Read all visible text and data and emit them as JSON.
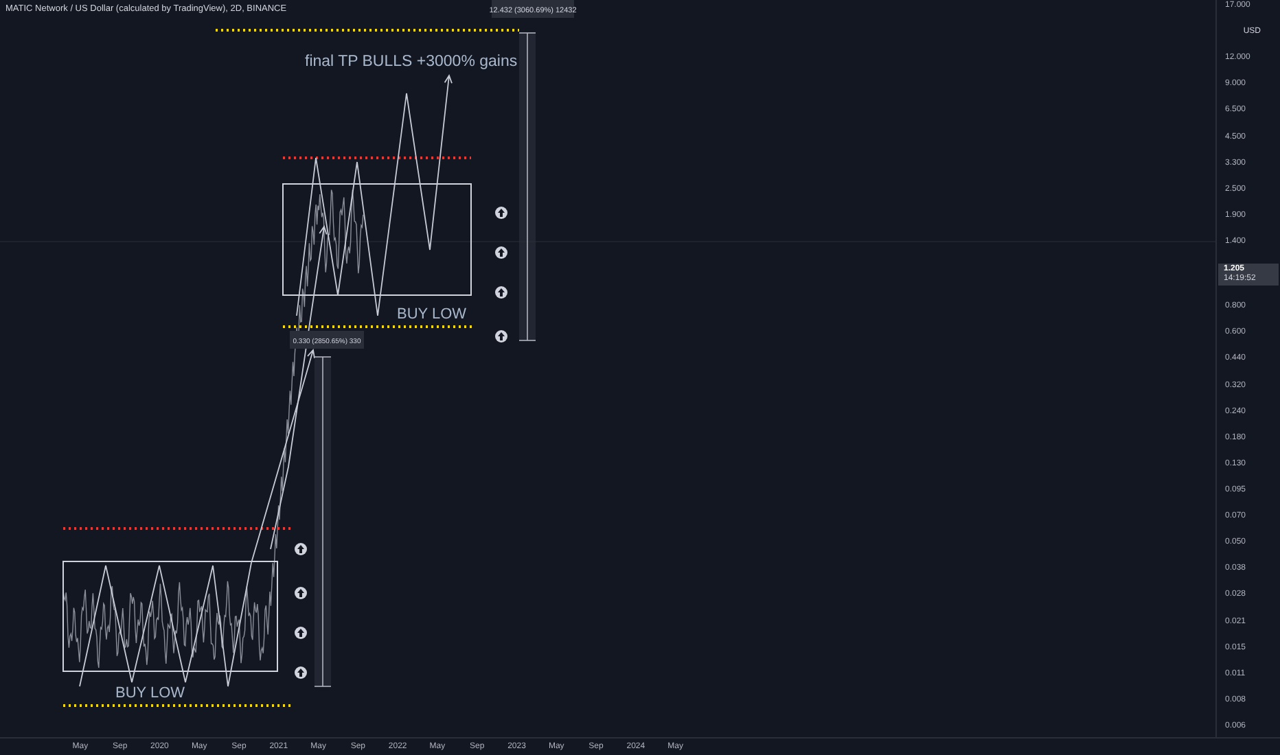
{
  "header": {
    "title": "MATIC Network / US Dollar (calculated by TradingView), 2D, BINANCE"
  },
  "chart": {
    "target_label": "final TP BULLS +3000% gains",
    "buy_labels": [
      "BUY LOW",
      "BUY LOW"
    ],
    "measures": [
      {
        "label": "12.432 (3060.69%) 12432"
      },
      {
        "label": "0.330 (2850.65%) 330"
      }
    ]
  },
  "price_axis": {
    "labels": [
      {
        "kind": "cut",
        "text": "17.000"
      },
      {
        "kind": "unit",
        "text": "USD"
      },
      {
        "kind": "tick",
        "text": "12.000"
      },
      {
        "kind": "tick",
        "text": "9.000"
      },
      {
        "kind": "tick",
        "text": "6.500"
      },
      {
        "kind": "tick",
        "text": "4.500"
      },
      {
        "kind": "tick",
        "text": "3.300"
      },
      {
        "kind": "tick",
        "text": "2.500"
      },
      {
        "kind": "tick",
        "text": "1.900"
      },
      {
        "kind": "tick",
        "text": "1.400"
      },
      {
        "kind": "tick",
        "text": "0.800"
      },
      {
        "kind": "tick",
        "text": "0.600"
      },
      {
        "kind": "tick",
        "text": "0.440"
      },
      {
        "kind": "tick",
        "text": "0.320"
      },
      {
        "kind": "tick",
        "text": "0.240"
      },
      {
        "kind": "tick",
        "text": "0.180"
      },
      {
        "kind": "tick",
        "text": "0.130"
      },
      {
        "kind": "tick",
        "text": "0.095"
      },
      {
        "kind": "tick",
        "text": "0.070"
      },
      {
        "kind": "tick",
        "text": "0.050"
      },
      {
        "kind": "tick",
        "text": "0.038"
      },
      {
        "kind": "tick",
        "text": "0.028"
      },
      {
        "kind": "tick",
        "text": "0.021"
      },
      {
        "kind": "tick",
        "text": "0.015"
      },
      {
        "kind": "tick",
        "text": "0.011"
      },
      {
        "kind": "tick",
        "text": "0.008"
      },
      {
        "kind": "tick",
        "text": "0.006"
      }
    ],
    "price_tag": {
      "price": "1.205",
      "countdown": "14:19:52"
    }
  },
  "time_axis": {
    "labels": [
      "May",
      "Sep",
      "2020",
      "May",
      "Sep",
      "2021",
      "May",
      "Sep",
      "2022",
      "May",
      "Sep",
      "2023",
      "May",
      "Sep",
      "2024",
      "May"
    ]
  }
}
